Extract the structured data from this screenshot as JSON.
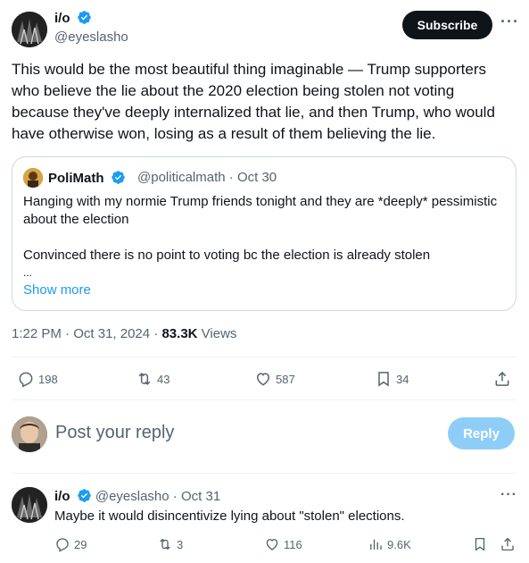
{
  "tweet": {
    "author_name": "i/o",
    "author_handle": "@eyeslasho",
    "subscribe_label": "Subscribe",
    "more_label": "···",
    "text": "This would be the most beautiful thing imaginable — Trump supporters who believe the lie about the 2020 election being stolen not voting because they've deeply internalized that lie, and then Trump, who would have otherwise won, losing as a result of them believing the lie.",
    "time": "1:22 PM",
    "date": "Oct 31, 2024",
    "views_count": "83.3K",
    "views_label": "Views",
    "actions": {
      "replies": "198",
      "retweets": "43",
      "likes": "587",
      "bookmarks": "34"
    }
  },
  "quote": {
    "name": "PoliMath",
    "handle": "@politicalmath",
    "date": "Oct 30",
    "line1": "Hanging with my normie Trump friends tonight and they are *deeply* pessimistic about the election",
    "line2": "Convinced there is no point to voting bc the election is already stolen",
    "ellipsis": "...",
    "show_more": "Show more"
  },
  "composer": {
    "placeholder": "Post your reply",
    "reply_label": "Reply"
  },
  "reply": {
    "name": "i/o",
    "handle": "@eyeslasho",
    "date": "Oct 31",
    "text": "Maybe it would disincentivize lying about \"stolen\" elections.",
    "more_label": "···",
    "actions": {
      "replies": "29",
      "retweets": "3",
      "likes": "116",
      "views": "9.6K"
    }
  },
  "colors": {
    "accent": "#1d9bf0",
    "muted": "#536471",
    "reply_button_disabled": "#8ecdf8",
    "text": "#0f1419"
  },
  "icons": [
    "verified-badge-icon",
    "reply-icon",
    "retweet-icon",
    "like-icon",
    "bookmark-icon",
    "share-icon",
    "views-icon"
  ]
}
